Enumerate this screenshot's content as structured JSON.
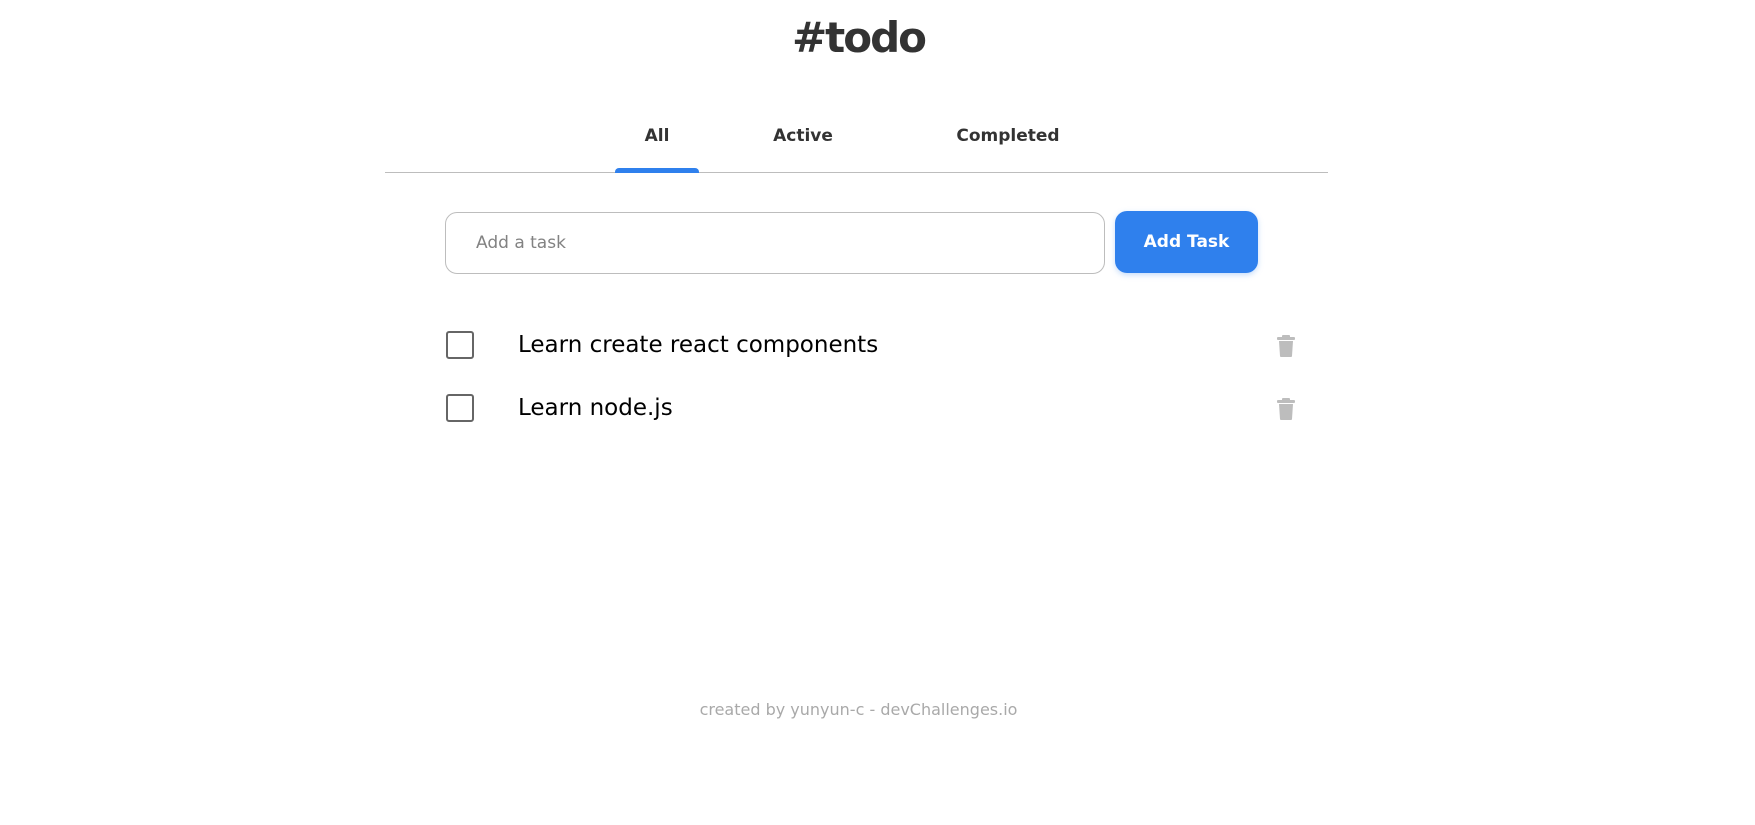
{
  "app": {
    "title": "#todo"
  },
  "tabs": [
    {
      "label": "All",
      "selected": true
    },
    {
      "label": "Active",
      "selected": false
    },
    {
      "label": "Completed",
      "selected": false
    }
  ],
  "add_form": {
    "input_placeholder": "Add a task",
    "input_value": "",
    "button_label": "Add Task"
  },
  "tasks": [
    {
      "label": "Learn create react components",
      "completed": false,
      "delete_icon": "trash-icon"
    },
    {
      "label": "Learn node.js",
      "completed": false,
      "delete_icon": "trash-icon"
    }
  ],
  "footer": {
    "text": "created by yunyun-c - devChallenges.io"
  },
  "colors": {
    "accent": "#2F80ED",
    "text": "#333333",
    "muted": "#A9A9A9",
    "border": "#BDBDBD",
    "icon": "#BDBDBD"
  }
}
